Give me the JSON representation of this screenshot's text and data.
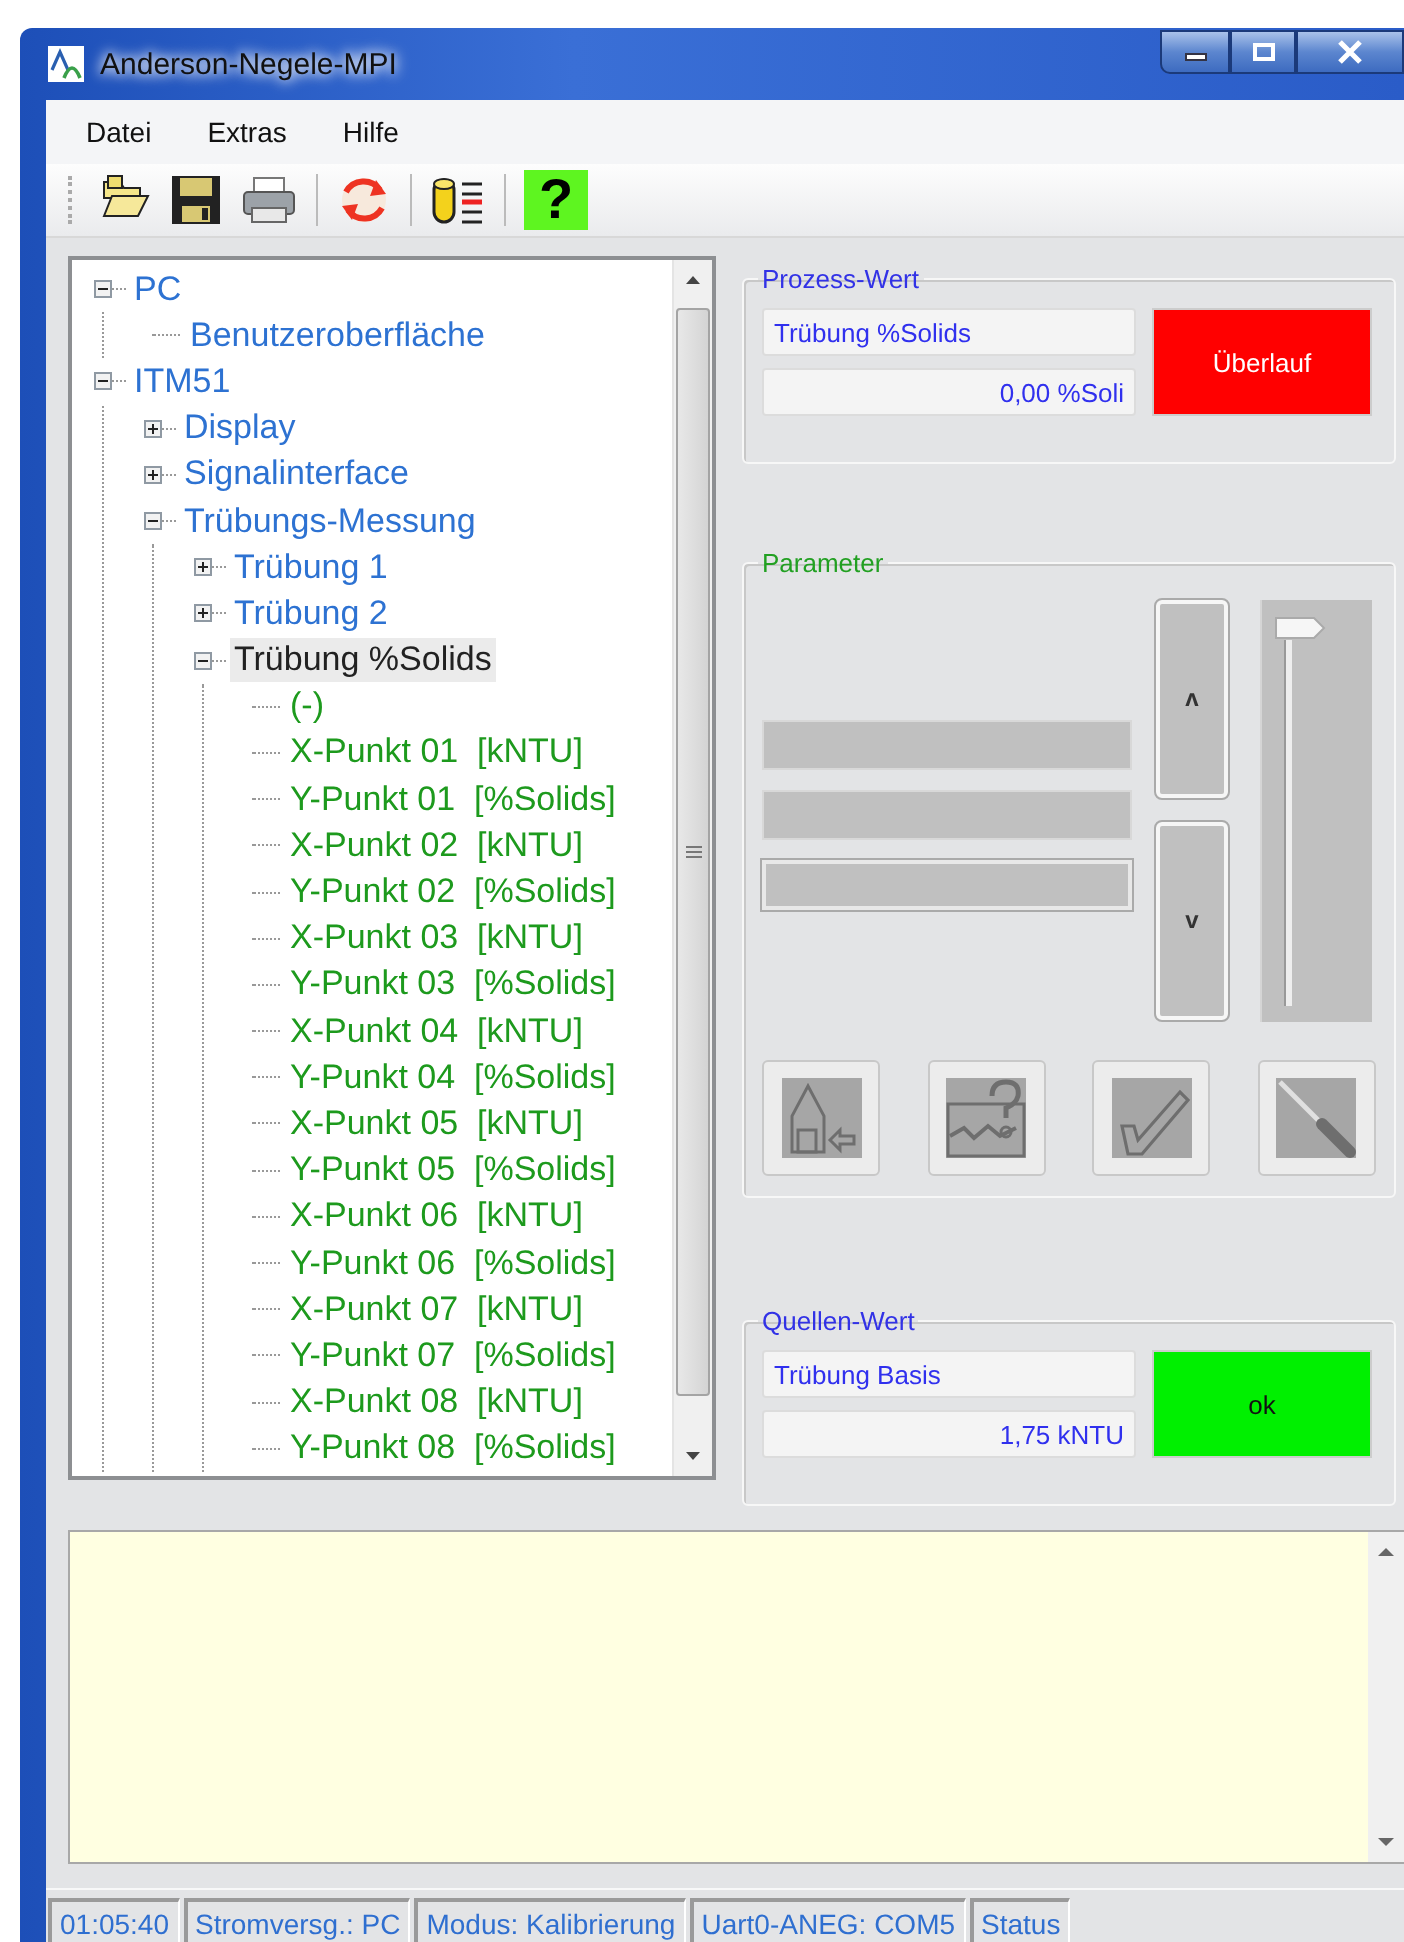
{
  "window": {
    "title": "Anderson-Negele-MPI"
  },
  "menu": [
    "Datei",
    "Extras",
    "Hilfe"
  ],
  "toolbar": [
    {
      "kind": "open",
      "separated": false
    },
    {
      "kind": "save",
      "separated": false
    },
    {
      "kind": "print",
      "separated": false
    },
    {
      "kind": "refresh",
      "separated": true
    },
    {
      "kind": "database",
      "separated": true
    },
    {
      "kind": "help",
      "separated": true,
      "label": "?"
    }
  ],
  "tree": [
    {
      "label": "PC",
      "kind": "group",
      "expanded": true,
      "selected": false,
      "children": [
        {
          "label": "Benutzeroberfläche",
          "kind": "group",
          "selected": false
        }
      ]
    },
    {
      "label": "ITM51",
      "kind": "group",
      "expanded": true,
      "selected": false,
      "children": [
        {
          "label": "Display",
          "kind": "group",
          "expanded": false,
          "selected": false
        },
        {
          "label": "Signalinterface",
          "kind": "group",
          "expanded": false,
          "selected": false
        },
        {
          "label": "Trübungs-Messung",
          "kind": "group",
          "expanded": true,
          "selected": false,
          "children": [
            {
              "label": "Trübung 1",
              "kind": "group",
              "expanded": false,
              "selected": false
            },
            {
              "label": "Trübung 2",
              "kind": "group",
              "expanded": false,
              "selected": false
            },
            {
              "label": "Trübung %Solids",
              "kind": "group",
              "expanded": true,
              "selected": true,
              "children": [
                {
                  "label": "(-)",
                  "kind": "parameter",
                  "selected": false
                },
                {
                  "label": "X-Punkt 01  [kNTU]",
                  "kind": "parameter",
                  "selected": false
                },
                {
                  "label": "Y-Punkt 01  [%Solids]",
                  "kind": "parameter",
                  "selected": false
                },
                {
                  "label": "X-Punkt 02  [kNTU]",
                  "kind": "parameter",
                  "selected": false
                },
                {
                  "label": "Y-Punkt 02  [%Solids]",
                  "kind": "parameter",
                  "selected": false
                },
                {
                  "label": "X-Punkt 03  [kNTU]",
                  "kind": "parameter",
                  "selected": false
                },
                {
                  "label": "Y-Punkt 03  [%Solids]",
                  "kind": "parameter",
                  "selected": false
                },
                {
                  "label": "X-Punkt 04  [kNTU]",
                  "kind": "parameter",
                  "selected": false
                },
                {
                  "label": "Y-Punkt 04  [%Solids]",
                  "kind": "parameter",
                  "selected": false
                },
                {
                  "label": "X-Punkt 05  [kNTU]",
                  "kind": "parameter",
                  "selected": false
                },
                {
                  "label": "Y-Punkt 05  [%Solids]",
                  "kind": "parameter",
                  "selected": false
                },
                {
                  "label": "X-Punkt 06  [kNTU]",
                  "kind": "parameter",
                  "selected": false
                },
                {
                  "label": "Y-Punkt 06  [%Solids]",
                  "kind": "parameter",
                  "selected": false
                },
                {
                  "label": "X-Punkt 07  [kNTU]",
                  "kind": "parameter",
                  "selected": false
                },
                {
                  "label": "Y-Punkt 07  [%Solids]",
                  "kind": "parameter",
                  "selected": false
                },
                {
                  "label": "X-Punkt 08  [kNTU]",
                  "kind": "parameter",
                  "selected": false
                },
                {
                  "label": "Y-Punkt 08  [%Solids]",
                  "kind": "parameter",
                  "selected": false
                }
              ]
            }
          ]
        }
      ]
    }
  ],
  "process_value": {
    "title": "Prozess-Wert",
    "name": "Trübung %Solids",
    "value": "0,00 %Soli",
    "alarm": true,
    "status_text": "Überlauf"
  },
  "parameter": {
    "title": "Parameter",
    "disabled": true,
    "fields": [
      {
        "kind": "plain"
      },
      {
        "kind": "plain"
      },
      {
        "kind": "framed"
      }
    ],
    "up_label": "ʌ",
    "down_label": "v",
    "slider": {
      "level": 1
    },
    "actions": [
      {
        "kind": "home"
      },
      {
        "kind": "chart-help"
      },
      {
        "kind": "check"
      },
      {
        "kind": "tool"
      }
    ]
  },
  "source_value": {
    "title": "Quellen-Wert",
    "name": "Trübung Basis",
    "value": "1,75 kNTU",
    "alarm": false,
    "status_text": "ok"
  },
  "status_bar": [
    "01:05:40",
    "Stromversg.: PC",
    "Modus: Kalibrierung",
    "Uart0-ANEG: COM5",
    "Status"
  ]
}
